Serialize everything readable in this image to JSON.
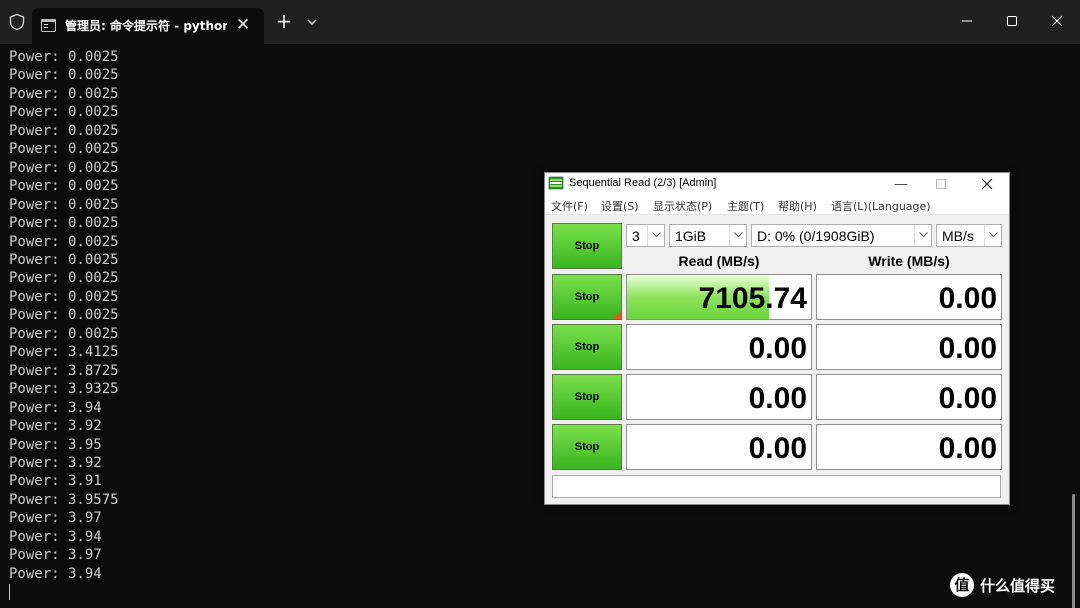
{
  "terminal": {
    "tab_title": "管理员: 命令提示符 - python ",
    "tab_close": "✕",
    "new_tab": "+",
    "lines": [
      "Power: 0.0025",
      "Power: 0.0025",
      "Power: 0.0025",
      "Power: 0.0025",
      "Power: 0.0025",
      "Power: 0.0025",
      "Power: 0.0025",
      "Power: 0.0025",
      "Power: 0.0025",
      "Power: 0.0025",
      "Power: 0.0025",
      "Power: 0.0025",
      "Power: 0.0025",
      "Power: 0.0025",
      "Power: 0.0025",
      "Power: 0.0025",
      "Power: 3.4125",
      "Power: 3.8725",
      "Power: 3.9325",
      "Power: 3.94",
      "Power: 3.92",
      "Power: 3.95",
      "Power: 3.92",
      "Power: 3.91",
      "Power: 3.9575",
      "Power: 3.97",
      "Power: 3.94",
      "Power: 3.97",
      "Power: 3.94"
    ]
  },
  "cdm": {
    "title": "Sequential Read (2/3) [Admin]",
    "menu": [
      "文件(F)",
      "设置(S)",
      "显示状态(P)",
      "主题(T)",
      "帮助(H)",
      "语言(L)(Language)"
    ],
    "count": "3",
    "size": "1GiB",
    "drive": "D: 0% (0/1908GiB)",
    "unit": "MB/s",
    "read_header": "Read (MB/s)",
    "write_header": "Write (MB/s)",
    "stop_label": "Stop",
    "rows": [
      {
        "read": "7105.74",
        "write": "0.00",
        "read_fill": 0.77
      },
      {
        "read": "0.00",
        "write": "0.00",
        "read_fill": 0
      },
      {
        "read": "0.00",
        "write": "0.00",
        "read_fill": 0
      },
      {
        "read": "0.00",
        "write": "0.00",
        "read_fill": 0
      }
    ],
    "comment": ""
  },
  "watermark": {
    "logo": "值",
    "text": "什么值得买"
  },
  "colors": {
    "terminal_bg": "#0c0c0c",
    "terminal_text": "#cccccc",
    "stop_green": "#4ccf2a",
    "bar_green": "#8ee25c"
  },
  "icons": [
    "shield-icon",
    "cmd-icon",
    "chevron-down-icon",
    "minimize-icon",
    "maximize-icon",
    "close-icon",
    "crystaldiskmark-icon"
  ]
}
